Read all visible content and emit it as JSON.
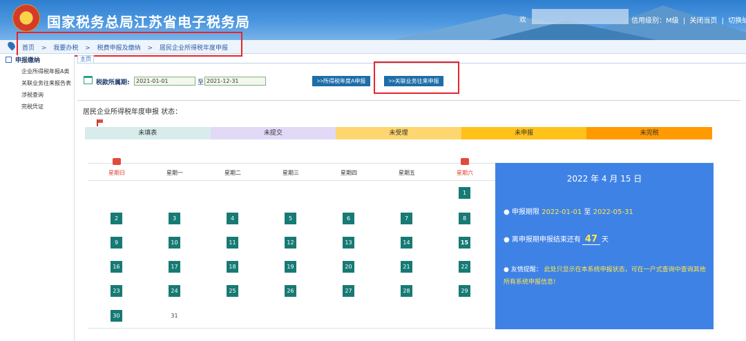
{
  "header": {
    "title": "国家税务总局江苏省电子税务局",
    "welcome": "欢",
    "credit_level": "信用级别：M级",
    "sep": "|",
    "close_page": "关闭当页",
    "switch_taxpayer": "切换纳税人"
  },
  "breadcrumb": [
    "首页",
    ">",
    "我要办税",
    ">",
    "税费申报及缴纳",
    ">",
    "居民企业所得税年度申报"
  ],
  "sidebar": {
    "heading": "申报缴纳",
    "items": [
      "企业所得税年报A类",
      "关联业务往来报告表",
      "涉税查询",
      "完税凭证"
    ]
  },
  "tab": "主页",
  "period": {
    "label": "税款所属期:",
    "start": "2021-01-01",
    "to": "至",
    "end": "2021-12-31"
  },
  "buttons": {
    "annual_a": ">>所得税年度A申报",
    "related": ">>关联业务往来申报"
  },
  "status_title": "居民企业所得税年度申报 状态：",
  "status_steps": [
    {
      "label": "未填表",
      "color": "#d8ecec"
    },
    {
      "label": "未提交",
      "color": "#e2d9f7"
    },
    {
      "label": "未受理",
      "color": "#fdd66f"
    },
    {
      "label": "未申报",
      "color": "#ffc21a"
    },
    {
      "label": "未完税",
      "color": "#ff9a00"
    }
  ],
  "calendar": {
    "weekdays": [
      "星期日",
      "星期一",
      "星期二",
      "星期三",
      "星期四",
      "星期五",
      "星期六"
    ],
    "first_weekday": 6,
    "days_in_month": 31,
    "highlighted_until": 30,
    "today": 15
  },
  "info": {
    "date": "2022 年 4 月 15 日",
    "period_label": "● 申报期限",
    "period_start": "2022-01-01",
    "period_to": "至",
    "period_end": "2022-05-31",
    "remaining_prefix": "● 离申报期申报结束还有",
    "remaining_days": "47",
    "remaining_suffix": "天",
    "tip_label": "● 友情提醒：",
    "tip_text": "此处只显示在本系统申报状态，可在一户式查询中查询其他所有系统申报信息!"
  }
}
